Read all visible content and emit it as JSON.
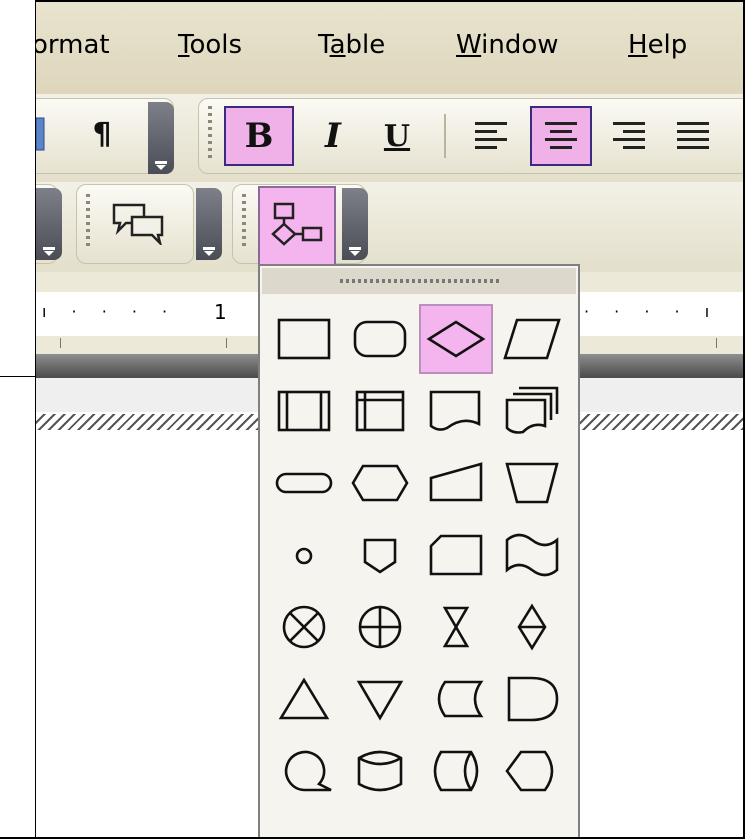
{
  "menu": {
    "items": [
      {
        "pre": "",
        "ul": "",
        "post": "ormat"
      },
      {
        "pre": "",
        "ul": "T",
        "post": "ools"
      },
      {
        "pre": "T",
        "ul": "a",
        "post": "ble"
      },
      {
        "pre": "",
        "ul": "W",
        "post": "indow"
      },
      {
        "pre": "",
        "ul": "H",
        "post": "elp"
      }
    ]
  },
  "formatting": {
    "paragraph_mark": "¶",
    "bold": "B",
    "italic": "I",
    "underline": "U"
  },
  "ruler": {
    "number": "1"
  },
  "colors": {
    "selected_fill": "#f4b4ee",
    "selected_border": "#3a2a80"
  },
  "palette": {
    "selected": "flowchart-decision",
    "shapes": [
      [
        "flowchart-process",
        "flowchart-alternate-process",
        "flowchart-decision",
        "flowchart-data"
      ],
      [
        "flowchart-predefined-process",
        "flowchart-internal-storage",
        "flowchart-document",
        "flowchart-multidocument"
      ],
      [
        "flowchart-terminator",
        "flowchart-preparation",
        "flowchart-manual-input",
        "flowchart-manual-operation"
      ],
      [
        "flowchart-connector",
        "flowchart-offpage-connector",
        "flowchart-card",
        "flowchart-punched-tape"
      ],
      [
        "flowchart-summing-junction",
        "flowchart-or",
        "flowchart-collate",
        "flowchart-sort"
      ],
      [
        "flowchart-extract",
        "flowchart-merge",
        "flowchart-stored-data",
        "flowchart-delay"
      ],
      [
        "flowchart-sequential-access-storage",
        "flowchart-magnetic-disk",
        "flowchart-direct-access-storage",
        "flowchart-display"
      ]
    ]
  }
}
